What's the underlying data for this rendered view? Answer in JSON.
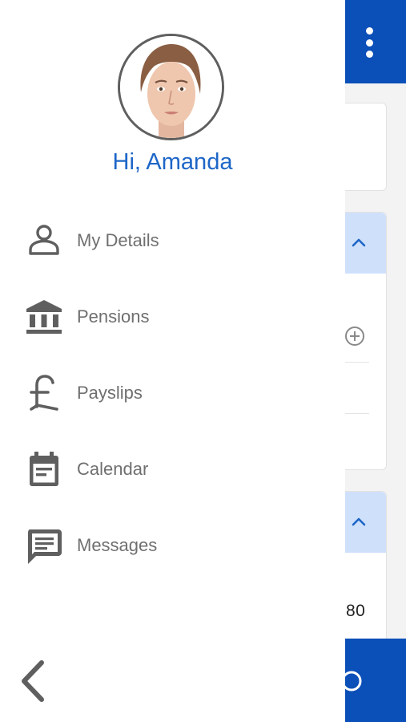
{
  "background": {
    "visible_value": "80",
    "header_menu_icon": "more-vert-icon"
  },
  "drawer": {
    "greeting": "Hi, Amanda",
    "avatar_icon": "user-avatar",
    "menu": [
      {
        "label": "My Details",
        "icon": "person-icon"
      },
      {
        "label": "Pensions",
        "icon": "bank-icon"
      },
      {
        "label": "Payslips",
        "icon": "pound-icon"
      },
      {
        "label": "Calendar",
        "icon": "calendar-icon"
      },
      {
        "label": "Messages",
        "icon": "message-icon"
      }
    ],
    "back_icon": "chevron-left-icon"
  },
  "colors": {
    "primary": "#0b4fb8",
    "greeting": "#1d66c7",
    "icon_gray": "#5f5f5f",
    "label_gray": "#6f6f6f",
    "card_header": "#cfe0fb"
  }
}
